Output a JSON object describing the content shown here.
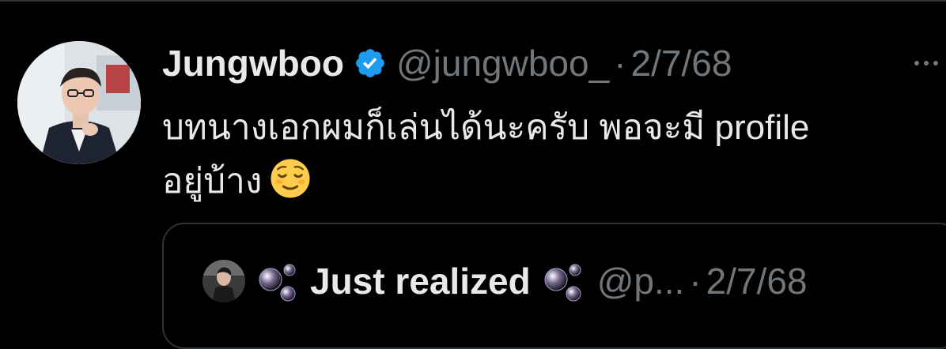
{
  "tweet": {
    "display_name": "Jungwboo",
    "handle": "@jungwboo_",
    "separator": "·",
    "date": "2/7/68",
    "text_line1": "บทนางเอกผมก็เล่นได้นะครับ พอจะมี profile",
    "text_line2": "อยู่บ้าง",
    "emoji": "relieved-face-emoji",
    "verified_icon": "verified-badge-icon",
    "more_icon": "more-options-icon"
  },
  "quote": {
    "display_name": "Just realized",
    "handle": "@p...",
    "separator": "·",
    "date": "2/7/68",
    "decor_icon": "bubbles-icon"
  },
  "colors": {
    "background": "#000000",
    "text_primary": "#e7e9ea",
    "text_secondary": "#71767b",
    "border": "#2f3336",
    "verified_blue": "#1d9bf0"
  }
}
